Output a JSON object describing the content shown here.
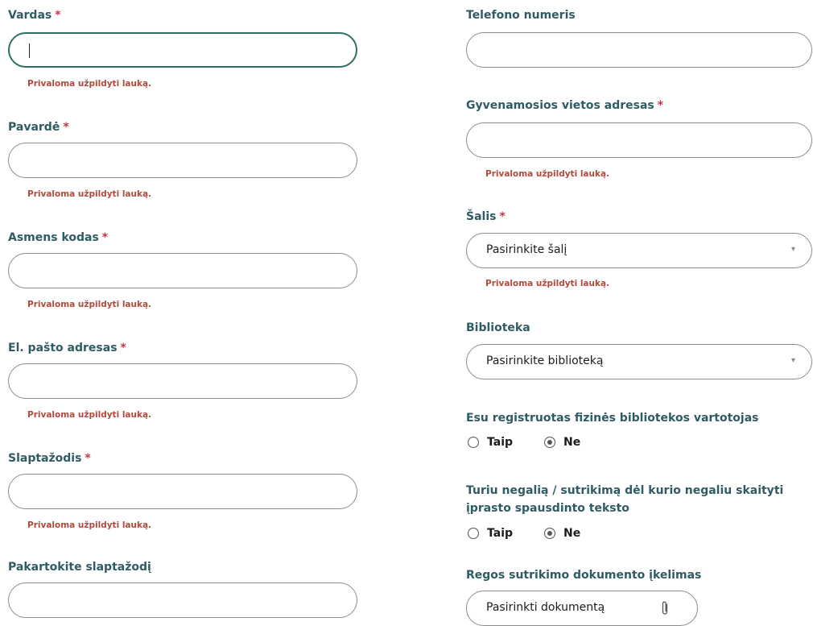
{
  "required_mark": "*",
  "error_text": "Privaloma užpildyti lauką.",
  "left": {
    "vardas": {
      "label": "Vardas",
      "value": ""
    },
    "pavarde": {
      "label": "Pavardė",
      "value": ""
    },
    "asmens_kodas": {
      "label": "Asmens kodas",
      "value": ""
    },
    "el_pastas": {
      "label": "El. pašto adresas",
      "value": ""
    },
    "slaptazodis": {
      "label": "Slaptažodis",
      "value": ""
    },
    "pakartokite": {
      "label": "Pakartokite slaptažodį",
      "value": ""
    }
  },
  "right": {
    "telefonas": {
      "label": "Telefono numeris",
      "value": ""
    },
    "adresas": {
      "label": "Gyvenamosios vietos adresas",
      "value": ""
    },
    "salis": {
      "label": "Šalis",
      "placeholder": "Pasirinkite šalį"
    },
    "biblioteka": {
      "label": "Biblioteka",
      "placeholder": "Pasirinkite biblioteką"
    },
    "registruotas": {
      "question": "Esu registruotas fizinės bibliotekos vartotojas",
      "yes": "Taip",
      "no": "Ne",
      "selected": "no"
    },
    "negalia": {
      "question": "Turiu negalią / sutrikimą dėl kurio negaliu skaityti įprasto spausdinto teksto",
      "yes": "Taip",
      "no": "Ne",
      "selected": "no"
    },
    "dokumentas": {
      "label": "Regos sutrikimo dokumento įkelimas",
      "button": "Pasirinkti dokumentą"
    }
  },
  "icons": {
    "select_chevron": "chevron-down-icon",
    "attach": "paperclip-icon"
  }
}
